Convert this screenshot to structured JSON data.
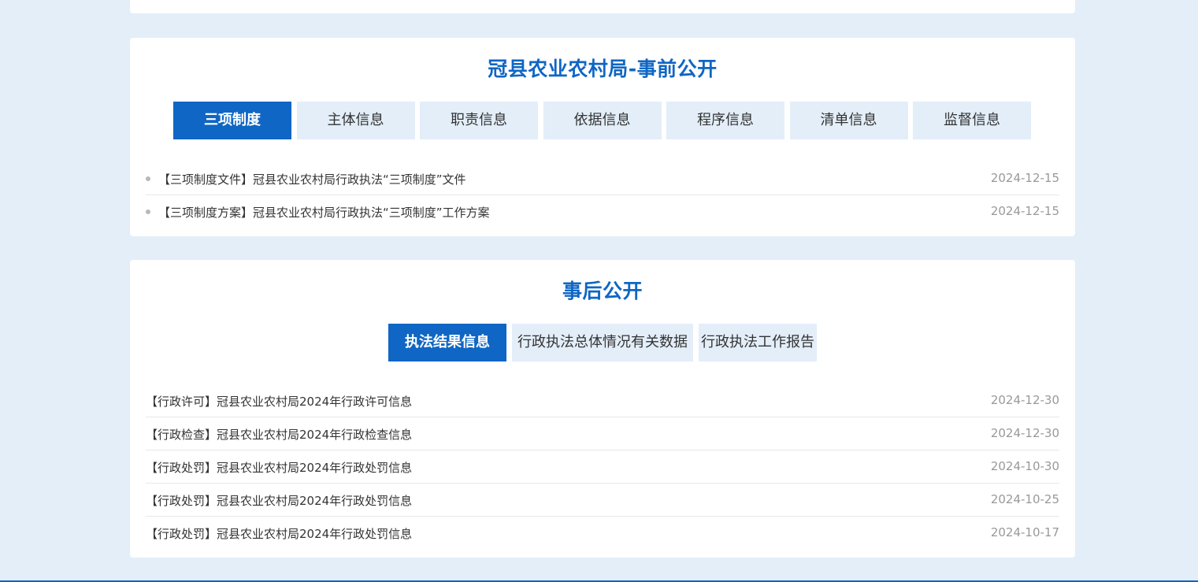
{
  "section1": {
    "title": "冠县农业农村局-事前公开",
    "tabs": [
      {
        "label": "三项制度",
        "active": true
      },
      {
        "label": "主体信息",
        "active": false
      },
      {
        "label": "职责信息",
        "active": false
      },
      {
        "label": "依据信息",
        "active": false
      },
      {
        "label": "程序信息",
        "active": false
      },
      {
        "label": "清单信息",
        "active": false
      },
      {
        "label": "监督信息",
        "active": false
      }
    ],
    "items": [
      {
        "title": "【三项制度文件】冠县农业农村局行政执法“三项制度”文件",
        "date": "2024-12-15"
      },
      {
        "title": "【三项制度方案】冠县农业农村局行政执法“三项制度”工作方案",
        "date": "2024-12-15"
      }
    ]
  },
  "section2": {
    "title": "事后公开",
    "tabs": [
      {
        "label": "执法结果信息",
        "active": true
      },
      {
        "label": "行政执法总体情况有关数据",
        "active": false
      },
      {
        "label": "行政执法工作报告",
        "active": false
      }
    ],
    "items": [
      {
        "title": "【行政许可】冠县农业农村局2024年行政许可信息",
        "date": "2024-12-30"
      },
      {
        "title": "【行政检查】冠县农业农村局2024年行政检查信息",
        "date": "2024-12-30"
      },
      {
        "title": "【行政处罚】冠县农业农村局2024年行政处罚信息",
        "date": "2024-10-30"
      },
      {
        "title": "【行政处罚】冠县农业农村局2024年行政处罚信息",
        "date": "2024-10-25"
      },
      {
        "title": "【行政处罚】冠县农业农村局2024年行政处罚信息",
        "date": "2024-10-17"
      }
    ]
  },
  "colors": {
    "accent": "#0f66c4",
    "background": "#e3eef9",
    "tab_inactive": "#e3eef9",
    "text": "#333333",
    "date": "#999999"
  }
}
